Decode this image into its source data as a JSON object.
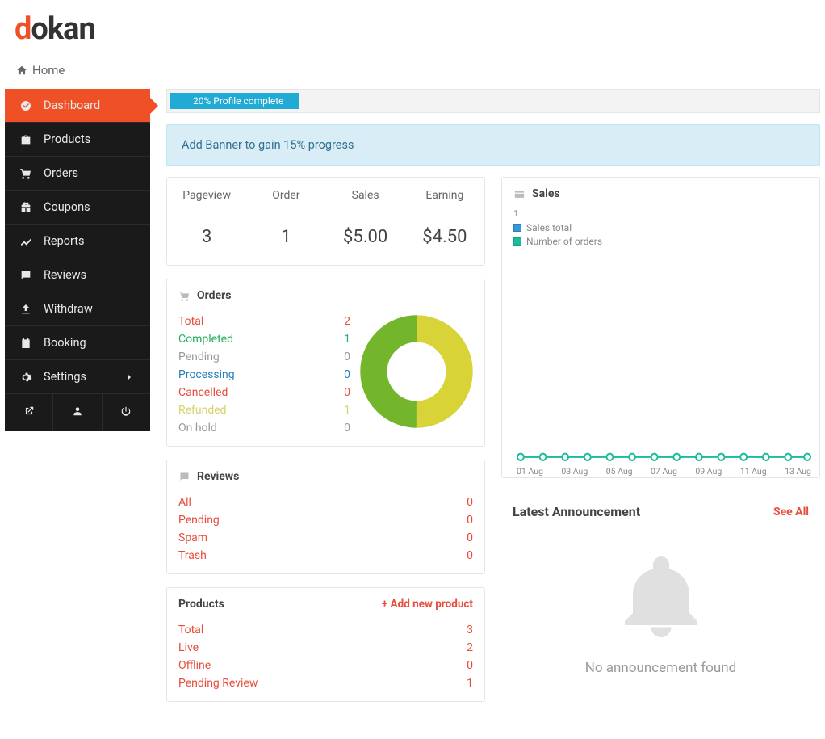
{
  "logo": {
    "d": "d",
    "rest": "okan"
  },
  "breadcrumb": "Home",
  "sidebar": {
    "items": [
      {
        "label": "Dashboard"
      },
      {
        "label": "Products"
      },
      {
        "label": "Orders"
      },
      {
        "label": "Coupons"
      },
      {
        "label": "Reports"
      },
      {
        "label": "Reviews"
      },
      {
        "label": "Withdraw"
      },
      {
        "label": "Booking"
      },
      {
        "label": "Settings"
      }
    ]
  },
  "profile": {
    "progress_text": "20% Profile complete",
    "alert_text": "Add Banner to gain 15% progress"
  },
  "stats": {
    "pageview": {
      "label": "Pageview",
      "value": "3"
    },
    "order": {
      "label": "Order",
      "value": "1"
    },
    "sales": {
      "label": "Sales",
      "value": "$5.00"
    },
    "earning": {
      "label": "Earning",
      "value": "$4.50"
    }
  },
  "orders_panel": {
    "title": "Orders",
    "rows": {
      "total": {
        "label": "Total",
        "value": "2"
      },
      "completed": {
        "label": "Completed",
        "value": "1"
      },
      "pending": {
        "label": "Pending",
        "value": "0"
      },
      "processing": {
        "label": "Processing",
        "value": "0"
      },
      "cancelled": {
        "label": "Cancelled",
        "value": "0"
      },
      "refunded": {
        "label": "Refunded",
        "value": "1"
      },
      "onhold": {
        "label": "On hold",
        "value": "0"
      }
    }
  },
  "reviews_panel": {
    "title": "Reviews",
    "rows": {
      "all": {
        "label": "All",
        "value": "0"
      },
      "pending": {
        "label": "Pending",
        "value": "0"
      },
      "spam": {
        "label": "Spam",
        "value": "0"
      },
      "trash": {
        "label": "Trash",
        "value": "0"
      }
    }
  },
  "products_panel": {
    "title": "Products",
    "add_label": "+ Add new product",
    "rows": {
      "total": {
        "label": "Total",
        "value": "3"
      },
      "live": {
        "label": "Live",
        "value": "2"
      },
      "offline": {
        "label": "Offline",
        "value": "0"
      },
      "pending": {
        "label": "Pending Review",
        "value": "1"
      }
    }
  },
  "sales_panel": {
    "title": "Sales",
    "y_max": "1",
    "legend": {
      "series1": "Sales total",
      "series2": "Number of orders"
    }
  },
  "announcement_panel": {
    "title": "Latest Announcement",
    "see_all": "See All",
    "empty_text": "No announcement found"
  },
  "chart_data": {
    "type": "line",
    "title": "Sales",
    "x": [
      "01 Aug",
      "02 Aug",
      "03 Aug",
      "04 Aug",
      "05 Aug",
      "06 Aug",
      "07 Aug",
      "08 Aug",
      "09 Aug",
      "10 Aug",
      "11 Aug",
      "12 Aug",
      "13 Aug",
      "14 Aug"
    ],
    "series": [
      {
        "name": "Sales total",
        "values": [
          0,
          0,
          0,
          0,
          0,
          0,
          0,
          0,
          0,
          0,
          0,
          0,
          0,
          0
        ]
      },
      {
        "name": "Number of orders",
        "values": [
          0,
          0,
          0,
          0,
          0,
          0,
          0,
          0,
          0,
          0,
          0,
          0,
          0,
          0
        ]
      }
    ],
    "x_ticks_shown": [
      "01 Aug",
      "03 Aug",
      "05 Aug",
      "07 Aug",
      "09 Aug",
      "11 Aug",
      "13 Aug"
    ],
    "ylim": [
      0,
      1
    ],
    "colors": {
      "Sales total": "#3498db",
      "Number of orders": "#1abc9c"
    }
  },
  "donut_data": {
    "type": "pie",
    "slices": [
      {
        "name": "Completed",
        "value": 1,
        "color": "#73b52b"
      },
      {
        "name": "Refunded",
        "value": 1,
        "color": "#d8d336"
      }
    ]
  }
}
